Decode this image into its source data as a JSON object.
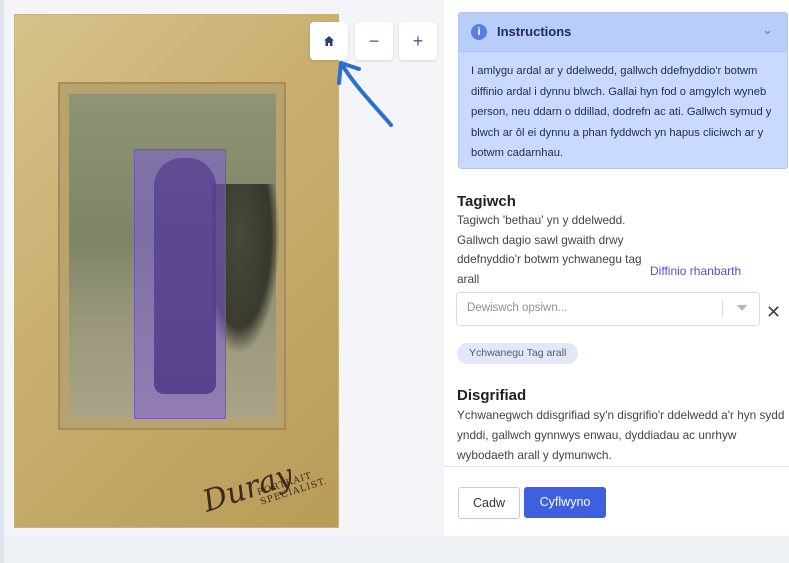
{
  "viewer": {
    "home_icon": "home-icon",
    "zoom_out_label": "−",
    "zoom_in_label": "+",
    "photo_signature": "Duray",
    "photo_caption": "PORTRAIT SPECIALIST."
  },
  "instructions": {
    "title": "Instructions",
    "body": "I amlygu ardal ar y ddelwedd, gallwch ddefnyddio'r botwm diffinio ardal i dynnu blwch. Gallai hyn fod o amgylch wyneb person, neu ddarn o ddillad, dodrefn ac ati. Gallwch symud y blwch ar ôl ei dynnu a phan fyddwch yn hapus cliciwch ar y botwm cadarnhau.",
    "icon": "info-icon",
    "collapse_icon": "chevron-down-icon"
  },
  "tags": {
    "heading": "Tagiwch",
    "description": "Tagiwch 'bethau' yn y ddelwedd. Gallwch dagio sawl gwaith drwy ddefnyddio'r botwm ychwanegu tag arall",
    "define_area_link": "Diffinio rhanbarth",
    "select_placeholder": "Dewiswch opsiwn...",
    "clear_label": "✕",
    "add_tag_label": "Ychwanegu Tag arall"
  },
  "description": {
    "heading": "Disgrifiad",
    "text": "Ychwanegwch ddisgrifiad sy'n disgrifio'r ddelwedd a'r hyn sydd ynddi, gallwch gynnwys enwau, dyddiadau ac unrhyw wybodaeth arall y dymunwch."
  },
  "actions": {
    "save_label": "Cadw",
    "submit_label": "Cyflwyno"
  },
  "colors": {
    "accent": "#3d5fe0",
    "highlight": "#7c5cd6",
    "instructions_bg": "#c9d9ff"
  }
}
